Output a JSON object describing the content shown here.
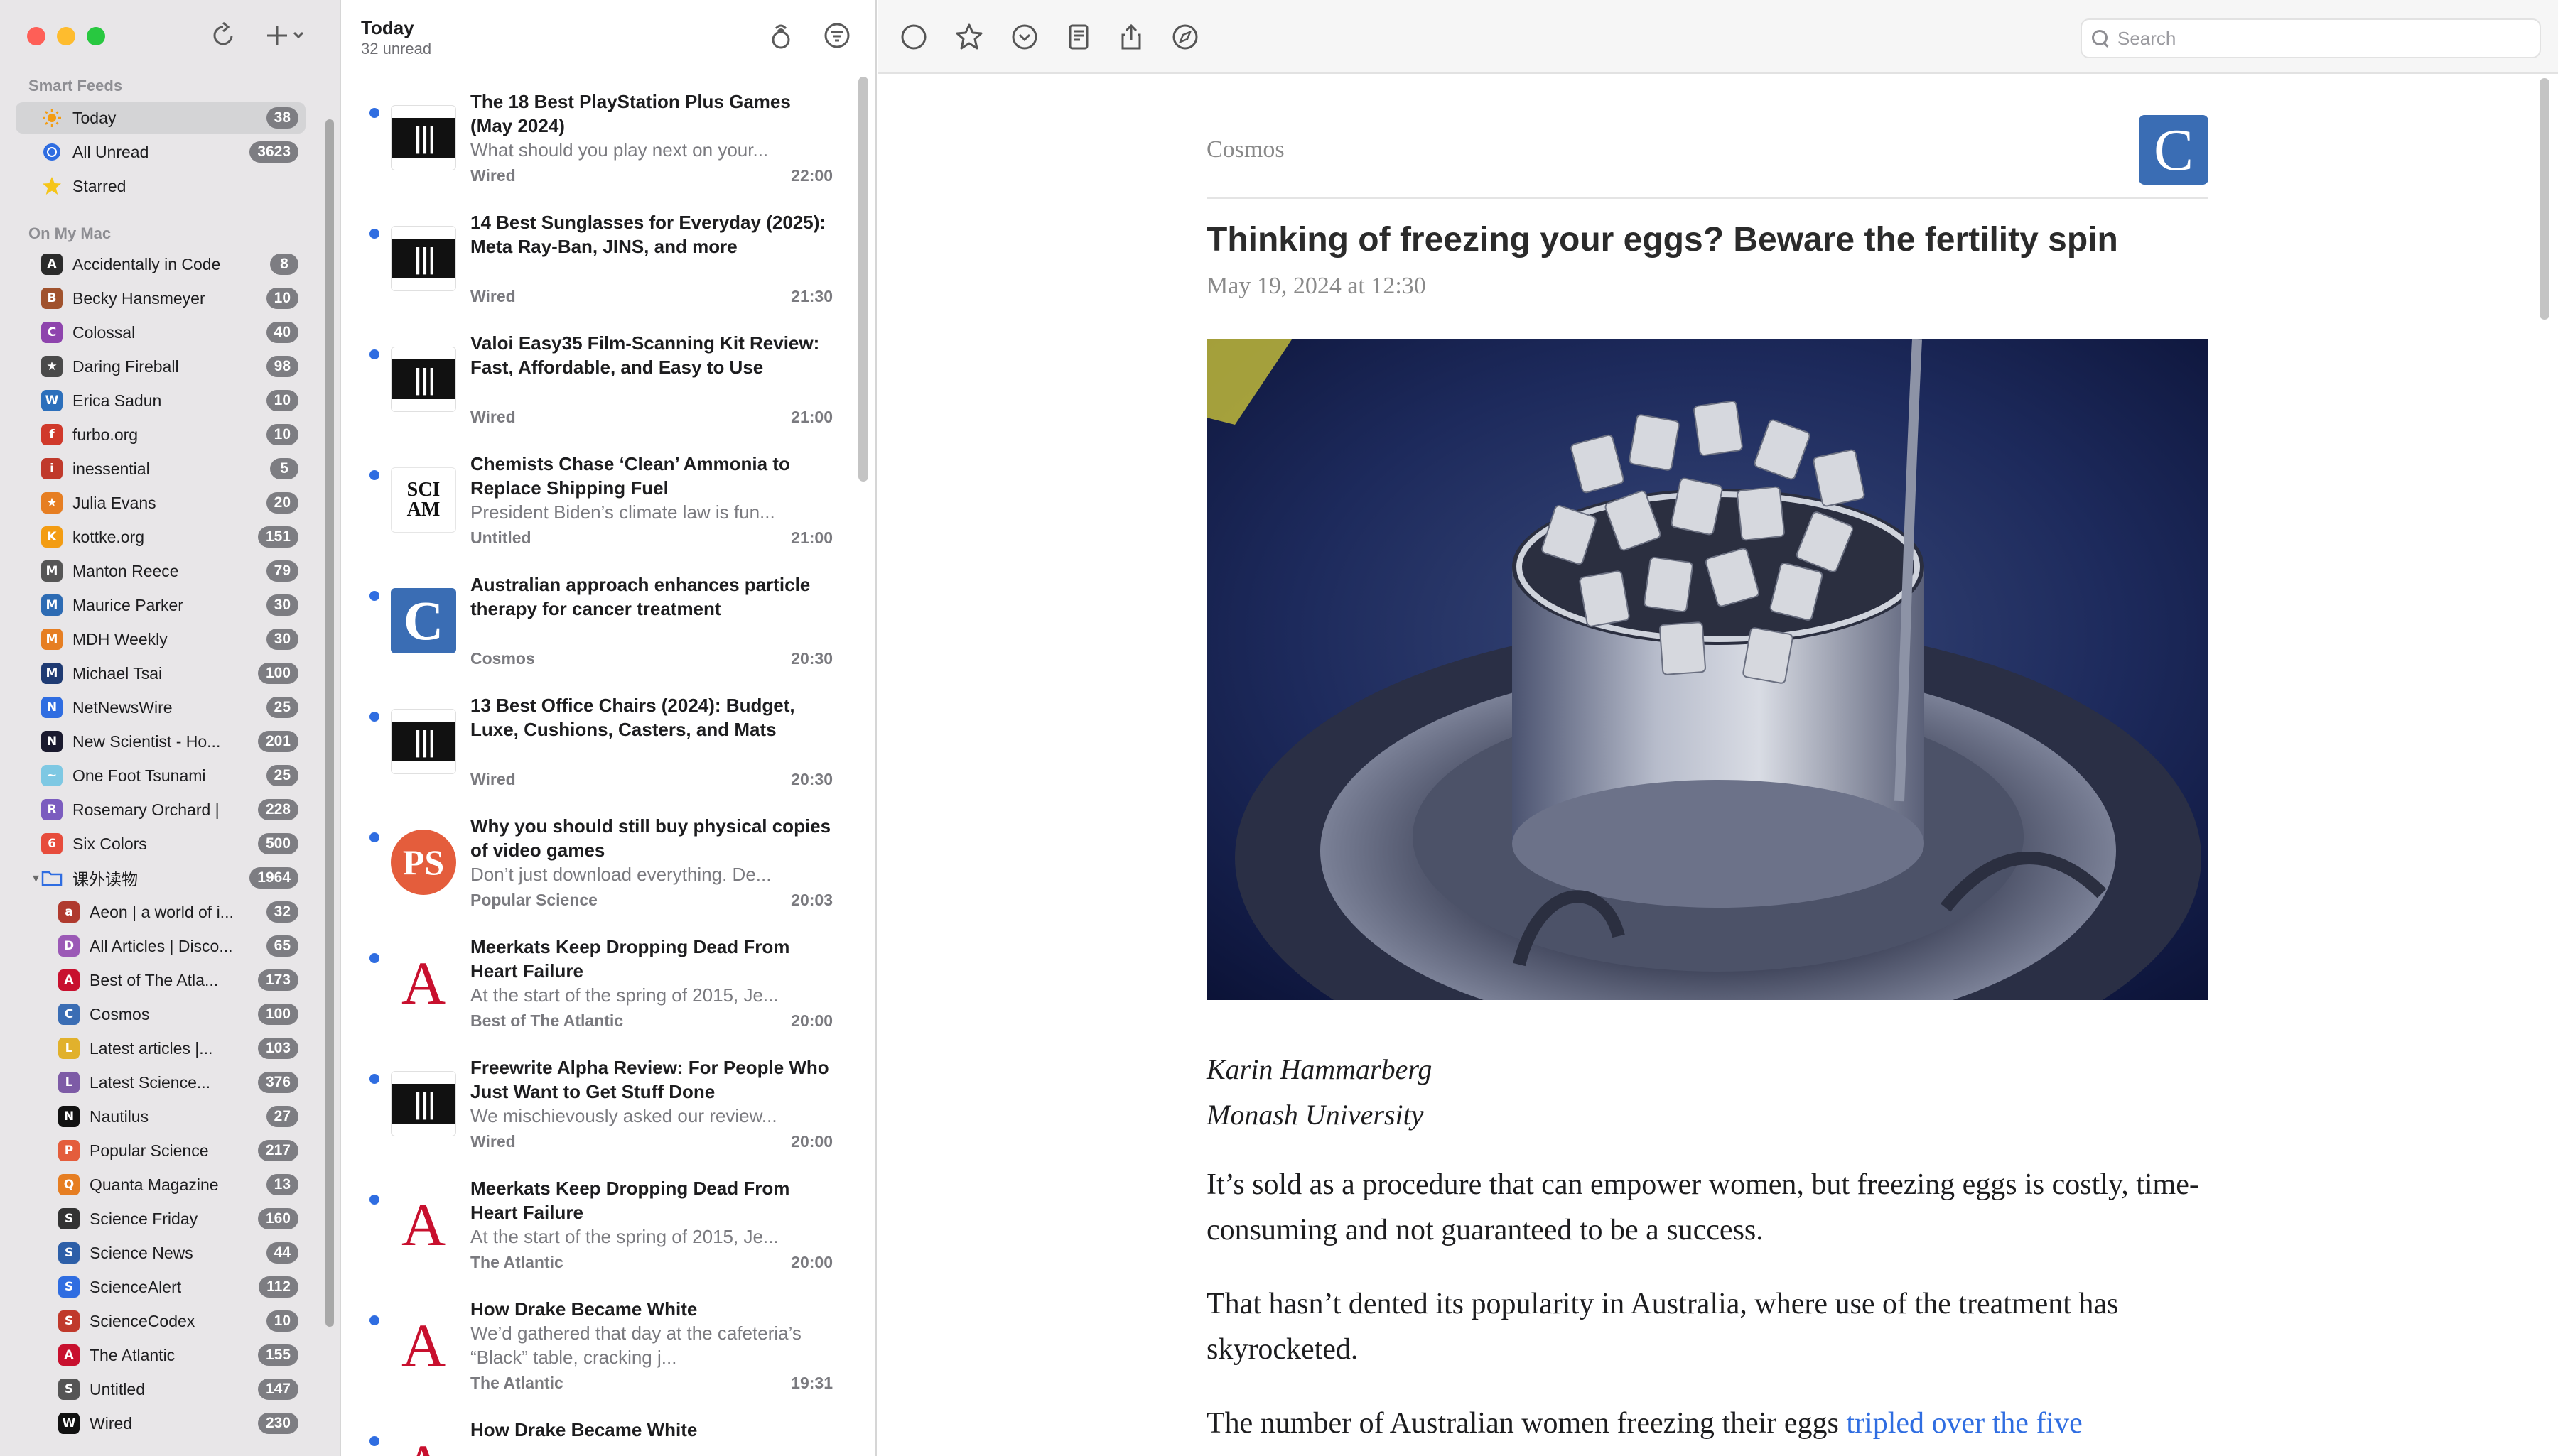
{
  "sidebar": {
    "smart_feeds_label": "Smart Feeds",
    "on_my_mac_label": "On My Mac",
    "smart_feeds": [
      {
        "name": "Today",
        "count": "38"
      },
      {
        "name": "All Unread",
        "count": "3623"
      },
      {
        "name": "Starred",
        "count": ""
      }
    ],
    "feeds": [
      {
        "name": "Accidentally in Code",
        "count": "8"
      },
      {
        "name": "Becky Hansmeyer",
        "count": "10"
      },
      {
        "name": "Colossal",
        "count": "40"
      },
      {
        "name": "Daring Fireball",
        "count": "98"
      },
      {
        "name": "Erica Sadun",
        "count": "10"
      },
      {
        "name": "furbo.org",
        "count": "10"
      },
      {
        "name": "inessential",
        "count": "5"
      },
      {
        "name": "Julia Evans",
        "count": "20"
      },
      {
        "name": "kottke.org",
        "count": "151"
      },
      {
        "name": "Manton Reece",
        "count": "79"
      },
      {
        "name": "Maurice Parker",
        "count": "30"
      },
      {
        "name": "MDH Weekly",
        "count": "30"
      },
      {
        "name": "Michael Tsai",
        "count": "100"
      },
      {
        "name": "NetNewsWire",
        "count": "25"
      },
      {
        "name": "New Scientist - Ho...",
        "count": "201"
      },
      {
        "name": "One Foot Tsunami",
        "count": "25"
      },
      {
        "name": "Rosemary Orchard |",
        "count": "228"
      },
      {
        "name": "Six Colors",
        "count": "500"
      }
    ],
    "folder": {
      "name": "课外读物",
      "count": "1964"
    },
    "folder_feeds": [
      {
        "name": "Aeon | a world of i...",
        "count": "32"
      },
      {
        "name": "All Articles | Disco...",
        "count": "65"
      },
      {
        "name": "Best of The Atla...",
        "count": "173"
      },
      {
        "name": "Cosmos",
        "count": "100"
      },
      {
        "name": "Latest articles |...",
        "count": "103"
      },
      {
        "name": "Latest Science...",
        "count": "376"
      },
      {
        "name": "Nautilus",
        "count": "27"
      },
      {
        "name": "Popular Science",
        "count": "217"
      },
      {
        "name": "Quanta Magazine",
        "count": "13"
      },
      {
        "name": "Science Friday",
        "count": "160"
      },
      {
        "name": "Science News",
        "count": "44"
      },
      {
        "name": "ScienceAlert",
        "count": "112"
      },
      {
        "name": "ScienceCodex",
        "count": "10"
      },
      {
        "name": "The Atlantic",
        "count": "155"
      },
      {
        "name": "Untitled",
        "count": "147"
      },
      {
        "name": "Wired",
        "count": "230"
      }
    ]
  },
  "timeline": {
    "title": "Today",
    "subtitle": "32 unread",
    "items": [
      {
        "title": "The 18 Best PlayStation Plus Games (May 2024)",
        "snippet": "What should you play next on your...",
        "source": "Wired",
        "time": "22:00",
        "thumb": "wired"
      },
      {
        "title": "14 Best Sunglasses for Everyday (2025): Meta Ray-Ban, JINS, and more",
        "snippet": "",
        "source": "Wired",
        "time": "21:30",
        "thumb": "wired"
      },
      {
        "title": "Valoi Easy35 Film-Scanning Kit Review: Fast, Affordable, and Easy to Use",
        "snippet": "",
        "source": "Wired",
        "time": "21:00",
        "thumb": "wired"
      },
      {
        "title": "Chemists Chase ‘Clean’ Ammonia to Replace Shipping Fuel",
        "snippet": "President Biden’s climate law is fun...",
        "source": "Untitled",
        "time": "21:00",
        "thumb": "sciam"
      },
      {
        "title": "Australian approach enhances particle therapy for cancer treatment",
        "snippet": "",
        "source": "Cosmos",
        "time": "20:30",
        "thumb": "cosmos"
      },
      {
        "title": "13 Best Office Chairs (2024): Budget, Luxe, Cushions, Casters, and Mats",
        "snippet": "",
        "source": "Wired",
        "time": "20:30",
        "thumb": "wired"
      },
      {
        "title": "Why you should still buy physical copies of video games",
        "snippet": "Don’t just download everything. De...",
        "source": "Popular Science",
        "time": "20:03",
        "thumb": "popsci"
      },
      {
        "title": "Meerkats Keep Dropping Dead From Heart Failure",
        "snippet": "At the start of the spring of 2015, Je...",
        "source": "Best of The Atlantic",
        "time": "20:00",
        "thumb": "atlantic"
      },
      {
        "title": "Freewrite Alpha Review: For People Who Just Want to Get Stuff Done",
        "snippet": "We mischievously asked our review...",
        "source": "Wired",
        "time": "20:00",
        "thumb": "wired"
      },
      {
        "title": "Meerkats Keep Dropping Dead From Heart Failure",
        "snippet": "At the start of the spring of 2015, Je...",
        "source": "The Atlantic",
        "time": "20:00",
        "thumb": "atlantic"
      },
      {
        "title": "How Drake Became White",
        "snippet": "We’d gathered that day at the cafeteria’s “Black” table, cracking j...",
        "source": "The Atlantic",
        "time": "19:31",
        "thumb": "atlantic"
      },
      {
        "title": "How Drake Became White",
        "snippet": "",
        "source": "",
        "time": "",
        "thumb": "atlantic"
      }
    ]
  },
  "toolbar": {
    "search_placeholder": "Search"
  },
  "article": {
    "feed": "Cosmos",
    "logo_letter": "C",
    "title": "Thinking of freezing your eggs? Beware the fertility spin",
    "date": "May 19, 2024 at 12:30",
    "author": "Karin Hammarberg",
    "affiliation": "Monash University",
    "p1": "It’s sold as a procedure that can empower women, but freezing eggs is costly, time-consuming and not guaranteed to be a success.",
    "p2": "That hasn’t dented its popularity in Australia, where use of the treatment has skyrocketed.",
    "p3_text": "The number of Australian women freezing their eggs ",
    "p3_link": "tripled over the five"
  },
  "colors": {
    "accent": "#2f6de1",
    "badge": "#7d7d82",
    "cosmos": "#3a6db4",
    "atlantic": "#c8102e"
  }
}
